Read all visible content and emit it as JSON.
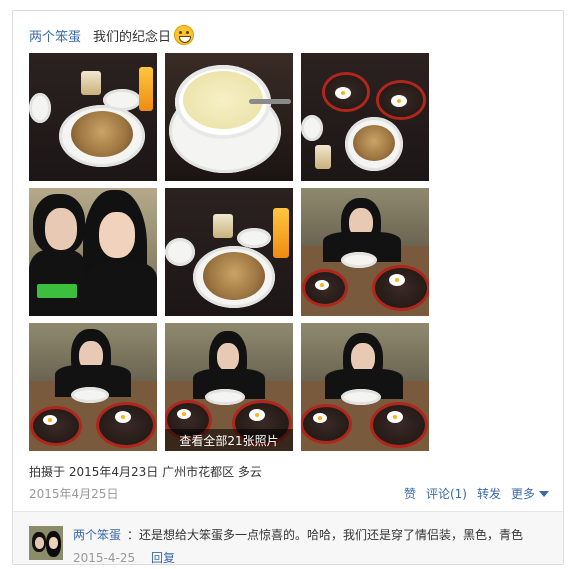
{
  "post": {
    "author": "两个笨蛋",
    "text": "我们的纪念日",
    "emoji": "grin-emoji"
  },
  "photos": {
    "view_all_label": "查看全部21张照片",
    "items": [
      {
        "subject": "pasta-plate"
      },
      {
        "subject": "soup-bowl"
      },
      {
        "subject": "sizzling-plates"
      },
      {
        "subject": "couple-selfie"
      },
      {
        "subject": "pasta-with-juice"
      },
      {
        "subject": "girl-at-table"
      },
      {
        "subject": "girl-at-table"
      },
      {
        "subject": "girl-at-table"
      },
      {
        "subject": "girl-at-table"
      }
    ]
  },
  "meta": {
    "shot_info": "拍摄于 2015年4月23日 广州市花都区 多云",
    "post_date": "2015年4月25日"
  },
  "actions": {
    "like": "赞",
    "comment": "评论(1)",
    "share": "转发",
    "more": "更多"
  },
  "comment": {
    "author": "两个笨蛋",
    "text": "：还是想给大笨蛋多一点惊喜的。哈哈，我们还是穿了情侣装，黑色，青色",
    "date": "2015-4-25",
    "reply_label": "回复"
  },
  "colors": {
    "link": "#3a6aa8",
    "muted": "#999999",
    "plate_red": "#b0261c"
  }
}
